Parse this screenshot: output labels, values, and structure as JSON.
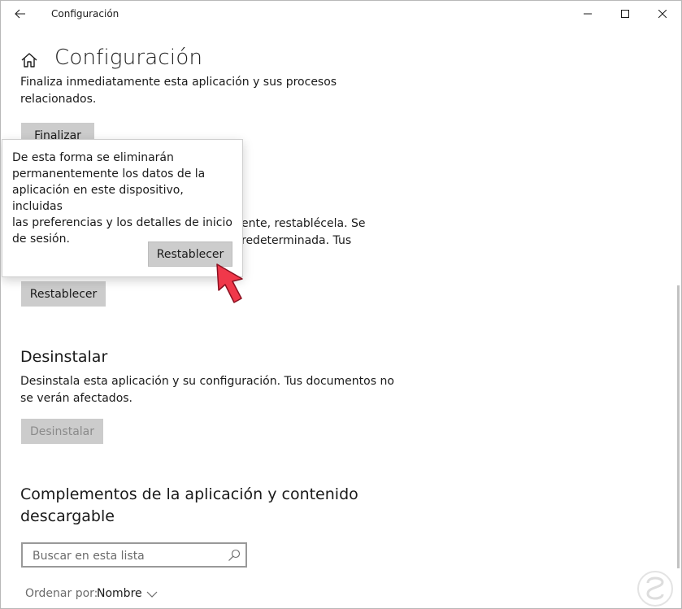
{
  "window": {
    "title": "Configuración",
    "controls": [
      "minimize-icon",
      "maximize-icon",
      "close-icon"
    ]
  },
  "header": {
    "title": "Configuración",
    "home_icon": "home-icon",
    "back_icon": "back-arrow-icon"
  },
  "finalizar": {
    "description_line1": "Finaliza inmediatamente esta aplicación y sus procesos",
    "description_line2": "relacionados.",
    "button": "Finalizar"
  },
  "restablecer": {
    "description_line1_tail": "ente, restablécela. Se",
    "description_line2_tail": "redeterminada. Tus",
    "button": "Restablecer"
  },
  "flyout": {
    "line1": "De esta forma se eliminarán",
    "line2": "permanentemente los datos de la",
    "line3": "aplicación en este dispositivo, incluidas",
    "line4": "las preferencias y los detalles de inicio",
    "line5": "de sesión.",
    "button": "Restablecer"
  },
  "desinstalar": {
    "heading": "Desinstalar",
    "description_line1": "Desinstala esta aplicación y su configuración. Tus documentos no",
    "description_line2": "se verán afectados.",
    "button": "Desinstalar"
  },
  "complementos": {
    "heading_line1": "Complementos de la aplicación y contenido",
    "heading_line2": "descargable",
    "search_placeholder": "Buscar en esta lista",
    "sort_label": "Ordenar por:",
    "sort_value": "Nombre"
  },
  "colors": {
    "button_bg": "#cccccc",
    "pointer_arrow": "#f0384a",
    "disabled_text": "#8a8a8a"
  }
}
